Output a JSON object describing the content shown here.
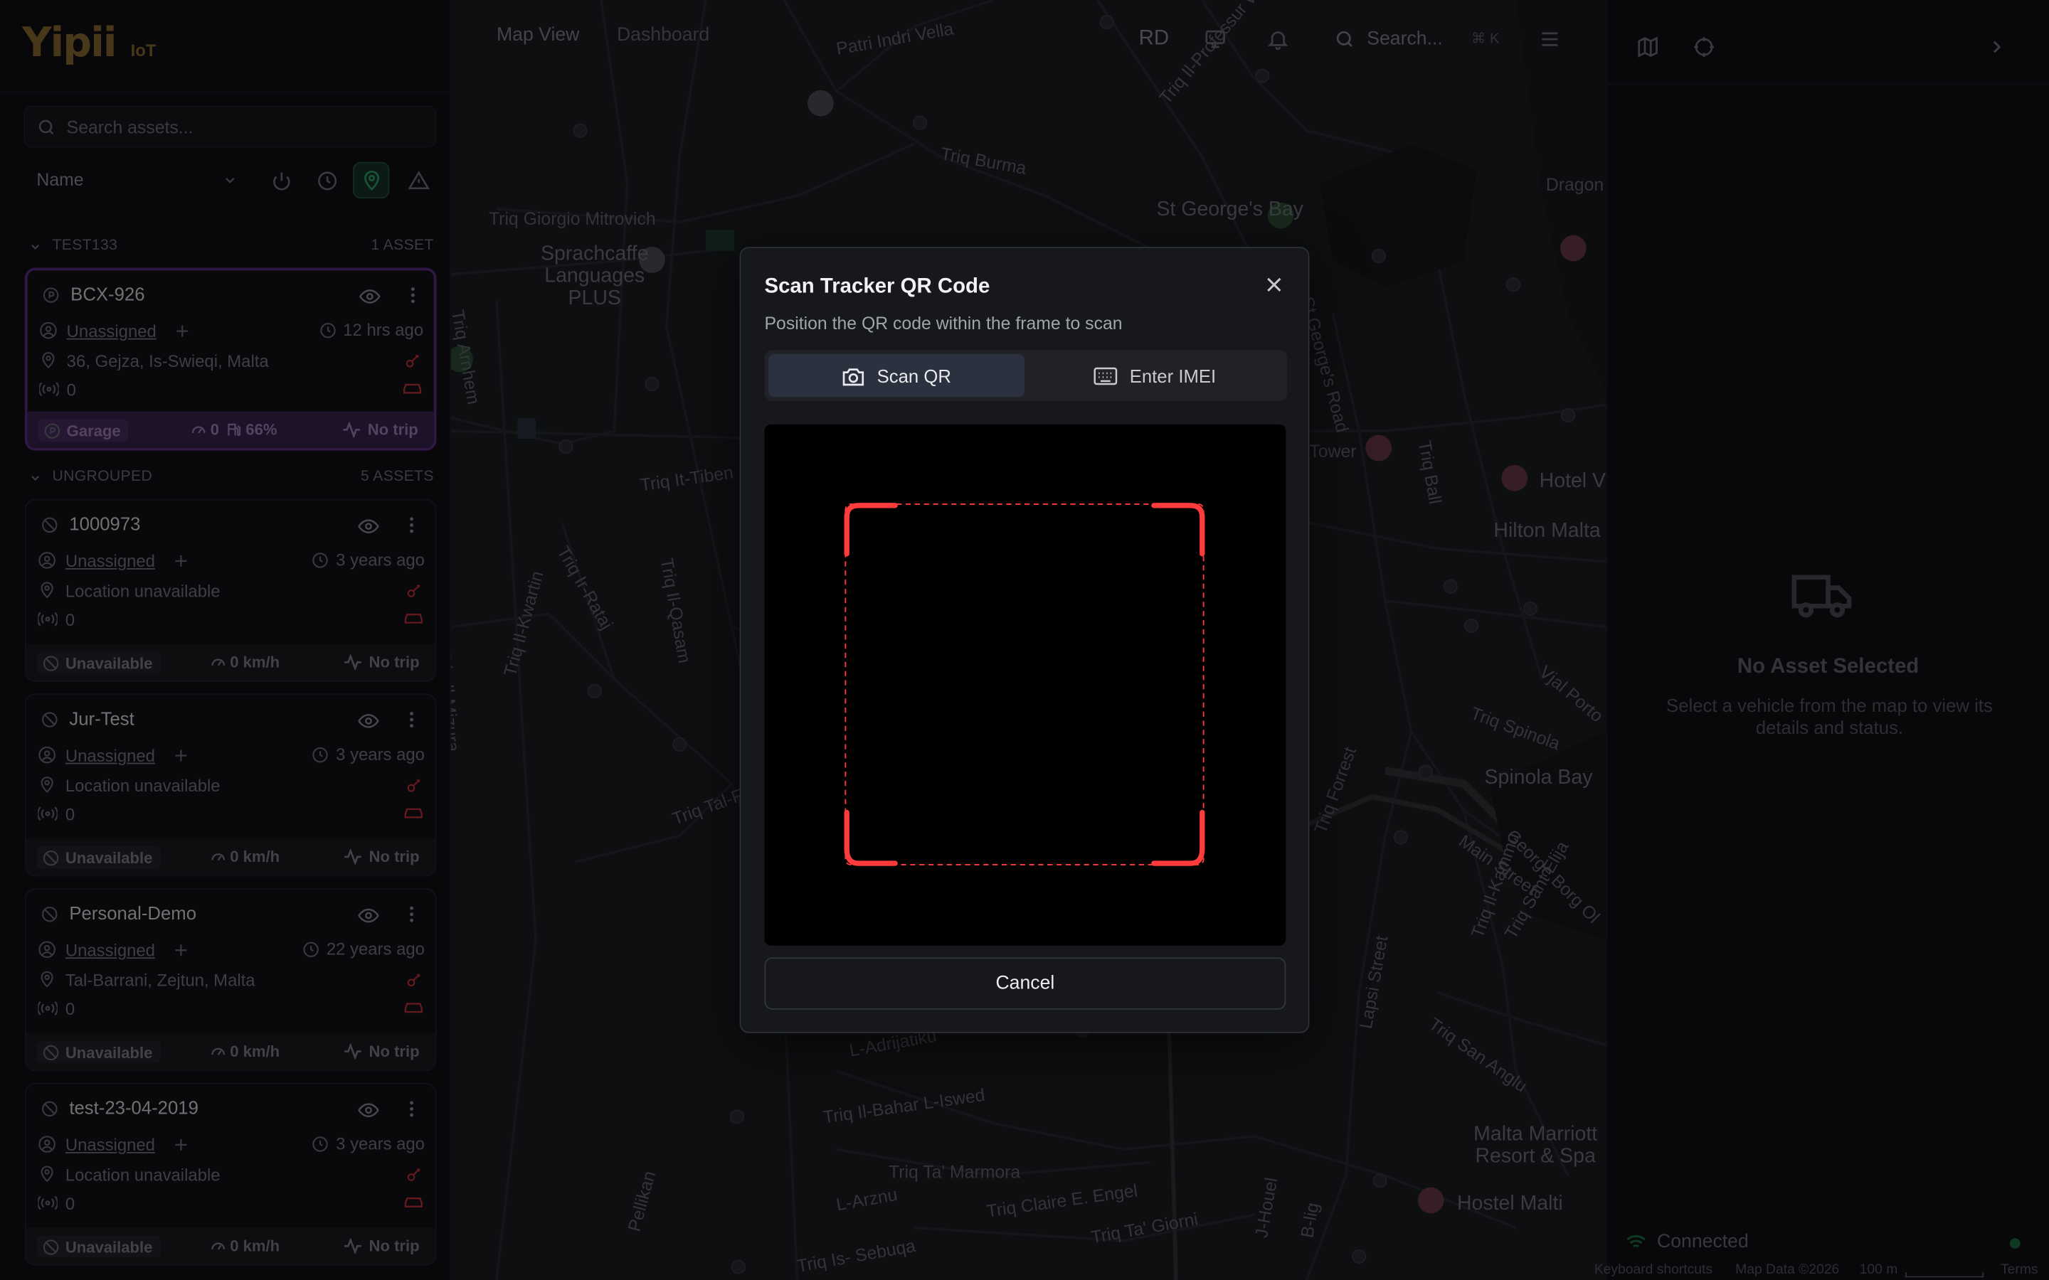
{
  "app": {
    "logo_text": "Yipii",
    "logo_suffix": "IoT"
  },
  "sidebar": {
    "search_placeholder": "Search assets...",
    "sort_value": "Name",
    "filter_icons": [
      "power-icon",
      "clock-icon",
      "location-pin-icon",
      "alert-triangle-icon"
    ],
    "groups": [
      {
        "name": "TEST133",
        "count": "1 ASSET",
        "assets": [
          {
            "name": "BCX-926",
            "assignee": "Unassigned",
            "time": "12 hrs ago",
            "location": "36, Gejza, Is-Swieqi, Malta",
            "signal": "0",
            "status": "Garage",
            "speed": "0",
            "fuel": "66%",
            "trip": "No trip"
          }
        ]
      },
      {
        "name": "UNGROUPED",
        "count": "5 ASSETS",
        "assets": [
          {
            "name": "1000973",
            "assignee": "Unassigned",
            "time": "3 years ago",
            "location": "Location unavailable",
            "signal": "0",
            "status": "Unavailable",
            "speed": "0 km/h",
            "trip": "No trip"
          },
          {
            "name": "Jur-Test",
            "assignee": "Unassigned",
            "time": "3 years ago",
            "location": "Location unavailable",
            "signal": "0",
            "status": "Unavailable",
            "speed": "0 km/h",
            "trip": "No trip"
          },
          {
            "name": "Personal-Demo",
            "assignee": "Unassigned",
            "time": "22 years ago",
            "location": "Tal-Barrani, Zejtun, Malta",
            "signal": "0",
            "status": "Unavailable",
            "speed": "0 km/h",
            "trip": "No trip"
          },
          {
            "name": "test-23-04-2019",
            "assignee": "Unassigned",
            "time": "3 years ago",
            "location": "Location unavailable",
            "signal": "0",
            "status": "Unavailable",
            "speed": "0 km/h",
            "trip": "No trip"
          }
        ]
      }
    ]
  },
  "topbar": {
    "nav": [
      "Map View",
      "Dashboard"
    ],
    "avatar_initials": "RD",
    "search_label": "Search...",
    "search_shortcut": "⌘ K"
  },
  "map": {
    "labels": [
      "Patri Indri Vella",
      "Triq Burma",
      "Triq Giorgio Mitrovich",
      "Sprachcaffe Languages PLUS",
      "St George's Bay",
      "Dragon",
      "Triq Il-Professur W.Ganado",
      "Triq Arnhem",
      "St George's Road",
      "Triq Ball",
      "Tower",
      "Hotel V",
      "Hilton Malta",
      "Triq It-Tiben",
      "Triq Ir-Rataj",
      "Triq Il-Qasam",
      "Triq Il-Mizura",
      "Triq Il-Kwartin",
      "Triq Tal-Fran",
      "Vjal Porto",
      "Triq Spinola",
      "Spinola Bay",
      "Main Street",
      "George Borg Ol",
      "Triq Forrest",
      "Triq Il-Kammu",
      "Triq Sant Elija",
      "Triq San Anglu",
      "Lapsi Street",
      "Malta Marriott Resort & Spa",
      "Hostel Malti",
      "L-Adrijatiku",
      "Triq Il-Bahar L-Iswed",
      "Triq Ta' Marmora",
      "L-Arznu",
      "Triq Claire E. Engel",
      "Triq Ta' Giorni",
      "Triq Is- Sebuqa",
      "Pellikan",
      "J-Houel",
      "B-lig"
    ],
    "footer": {
      "shortcuts": "Keyboard shortcuts",
      "copyright": "Map Data ©2026",
      "scale": "100 m",
      "terms": "Terms"
    }
  },
  "right_panel": {
    "empty_title": "No Asset Selected",
    "empty_desc": "Select a vehicle from the map to view its details and status.",
    "connection": "Connected",
    "connection_color": "#1f6e40"
  },
  "dialog": {
    "title": "Scan Tracker QR Code",
    "description": "Position the QR code within the frame to scan",
    "tabs": [
      {
        "label": "Scan QR",
        "icon": "camera-icon",
        "active": true
      },
      {
        "label": "Enter IMEI",
        "icon": "keyboard-icon",
        "active": false
      }
    ],
    "frame_color": "#ff3b3b",
    "cancel_label": "Cancel"
  },
  "colors": {
    "brand": "#8a6a2e",
    "selected_card": "#5b2f86",
    "alert_red": "#c3303a",
    "active_filter": "#2ea66a"
  }
}
